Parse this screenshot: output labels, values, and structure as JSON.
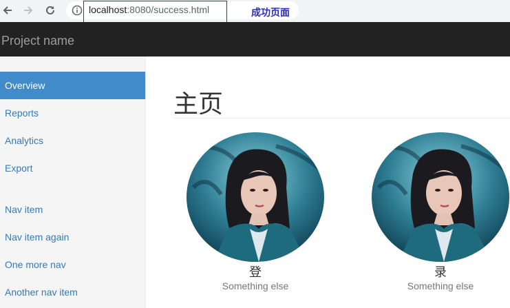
{
  "browser": {
    "url_host": "localhost",
    "url_path": ":8080/success.html",
    "annotation": "成功页面"
  },
  "navbar": {
    "brand": "Project name"
  },
  "sidebar": {
    "items": [
      {
        "label": "Overview",
        "active": true
      },
      {
        "label": "Reports"
      },
      {
        "label": "Analytics"
      },
      {
        "label": "Export"
      },
      {
        "label": "Nav item"
      },
      {
        "label": "Nav item again"
      },
      {
        "label": "One more nav"
      },
      {
        "label": "Another nav item"
      }
    ]
  },
  "main": {
    "title": "主页",
    "placeholders": [
      {
        "label": "登",
        "sub": "Something else"
      },
      {
        "label": "录",
        "sub": "Something else"
      }
    ]
  },
  "colors": {
    "navbar_bg": "#222222",
    "sidebar_active": "#428bca",
    "link": "#337ab7",
    "annotation": "#2b2bbf"
  }
}
